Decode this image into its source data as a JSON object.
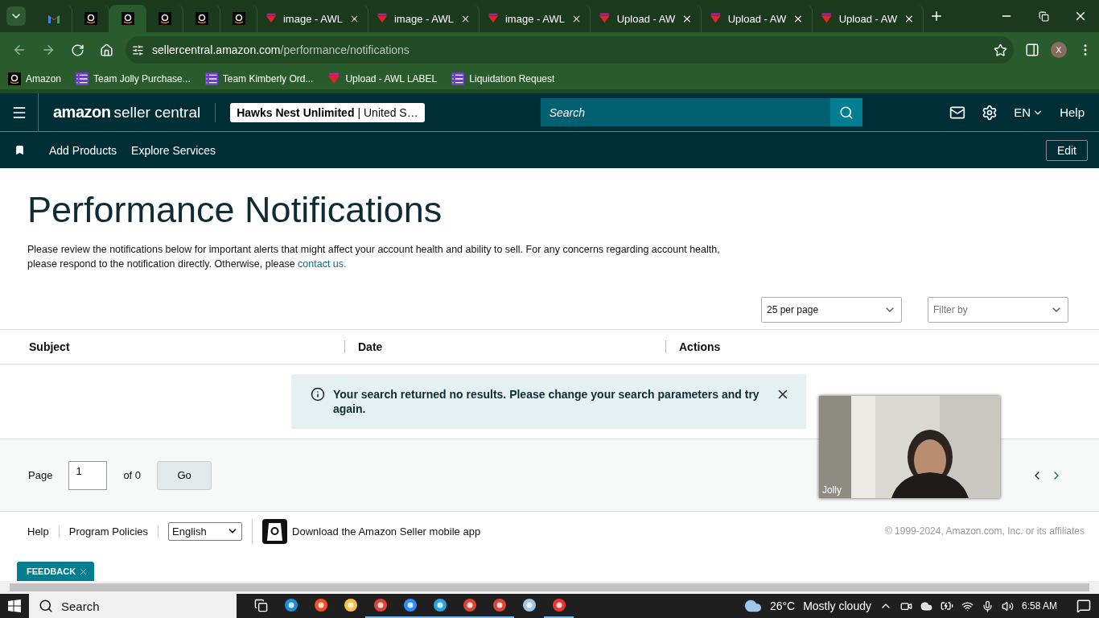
{
  "browser": {
    "tabs": [
      {
        "kind": "gmail",
        "selected": false
      },
      {
        "kind": "amazon",
        "selected": false
      },
      {
        "kind": "amazon",
        "selected": true
      },
      {
        "kind": "amazon",
        "selected": false
      },
      {
        "kind": "amazon",
        "selected": false
      },
      {
        "kind": "amazon",
        "selected": false
      },
      {
        "kind": "awl",
        "title": "image - AWL",
        "selected": false
      },
      {
        "kind": "awl",
        "title": "image - AWL",
        "selected": false
      },
      {
        "kind": "awl",
        "title": "image - AWL",
        "selected": false
      },
      {
        "kind": "awl",
        "title": "Upload - AW",
        "selected": false
      },
      {
        "kind": "awl",
        "title": "Upload - AW",
        "selected": false
      },
      {
        "kind": "awl",
        "title": "Upload - AW",
        "selected": false
      }
    ],
    "address": {
      "domain": "sellercentral.amazon.com",
      "path": "/performance/notifications"
    },
    "profile": "X",
    "bookmarks": [
      {
        "kind": "amazon",
        "label": "Amazon"
      },
      {
        "kind": "list",
        "label": "Team Jolly Purchase..."
      },
      {
        "kind": "list",
        "label": "Team Kimberly Ord..."
      },
      {
        "kind": "awl",
        "label": "Upload - AWL LABEL"
      },
      {
        "kind": "list",
        "label": "Liquidation Request"
      }
    ]
  },
  "header": {
    "logo_brand": "amazon",
    "logo_product": "seller central",
    "store_name": "Hawks Nest Unlimited",
    "store_region": "| United S…",
    "search_placeholder": "Search",
    "language": "EN",
    "help": "Help"
  },
  "subnav": {
    "links": [
      "Add Products",
      "Explore Services"
    ],
    "edit": "Edit"
  },
  "page": {
    "title": "Performance Notifications",
    "description": "Please review the notifications below for important alerts that might affect your account health and ability to sell. For any concerns regarding account health, please respond to the notification directly. Otherwise, please ",
    "link": "contact us.",
    "per_page": "25 per page",
    "filter_placeholder": "Filter by",
    "columns": [
      "Subject",
      "Date",
      "Actions"
    ],
    "alert": "Your search returned no results. Please change your search parameters and try again.",
    "pagination": {
      "label": "Page",
      "value": "1",
      "total": "of 0",
      "go": "Go"
    }
  },
  "footer": {
    "links": [
      "Help",
      "Program Policies"
    ],
    "language": "English",
    "app": "Download the Amazon Seller mobile app",
    "copyright": "© 1999-2024, Amazon.com, Inc. or its affiliates"
  },
  "feedback": "FEEDBACK",
  "video": {
    "kind": "picture",
    "name": "Jolly"
  },
  "taskbar": {
    "search": "Search",
    "apps": [
      {
        "kind": "taskview",
        "active": false
      },
      {
        "kind": "edge",
        "active": false
      },
      {
        "kind": "store",
        "active": false
      },
      {
        "kind": "explorer",
        "active": false
      },
      {
        "kind": "chrome",
        "active": true
      },
      {
        "kind": "zoom",
        "active": true
      },
      {
        "kind": "telegram",
        "active": true
      },
      {
        "kind": "chrome",
        "active": true
      },
      {
        "kind": "chrome",
        "active": true
      },
      {
        "kind": "notepad",
        "active": false
      },
      {
        "kind": "snip",
        "active": true
      }
    ],
    "temperature": "26°C",
    "weather": "Mostly cloudy",
    "time": "6:58 AM"
  }
}
